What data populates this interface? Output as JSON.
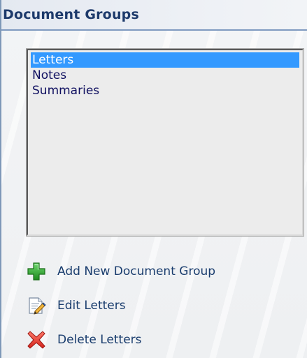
{
  "panel": {
    "title": "Document Groups"
  },
  "list": {
    "items": [
      {
        "label": "Letters",
        "selected": true
      },
      {
        "label": "Notes",
        "selected": false
      },
      {
        "label": "Summaries",
        "selected": false
      }
    ]
  },
  "actions": {
    "add": {
      "label": "Add New Document Group",
      "icon": "plus-icon"
    },
    "edit": {
      "label": "Edit Letters",
      "icon": "edit-document-icon"
    },
    "delete": {
      "label": "Delete Letters",
      "icon": "delete-x-icon"
    }
  },
  "colors": {
    "title": "#1d3a6b",
    "selection": "#3399ff",
    "link": "#1a3d6e",
    "add_icon": "#2e9e2e",
    "delete_icon": "#e0302a"
  }
}
